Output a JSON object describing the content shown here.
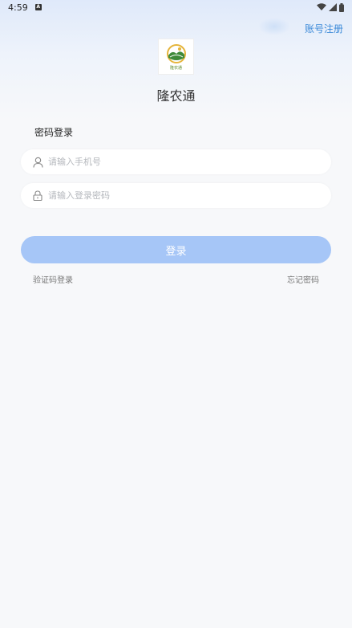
{
  "status_bar": {
    "time": "4:59",
    "notification_icon": "A"
  },
  "header": {
    "register_link": "账号注册"
  },
  "app": {
    "title": "隆农通",
    "logo_caption": "隆农通"
  },
  "form": {
    "section_title": "密码登录",
    "phone": {
      "placeholder": "请输入手机号",
      "value": ""
    },
    "password": {
      "placeholder": "请输入登录密码",
      "value": ""
    },
    "login_button": "登录"
  },
  "links": {
    "code_login": "验证码登录",
    "forgot_password": "忘记密码"
  },
  "colors": {
    "accent": "#3d8bd9",
    "button": "#a6c6f7",
    "background": "#f7f8fa"
  }
}
